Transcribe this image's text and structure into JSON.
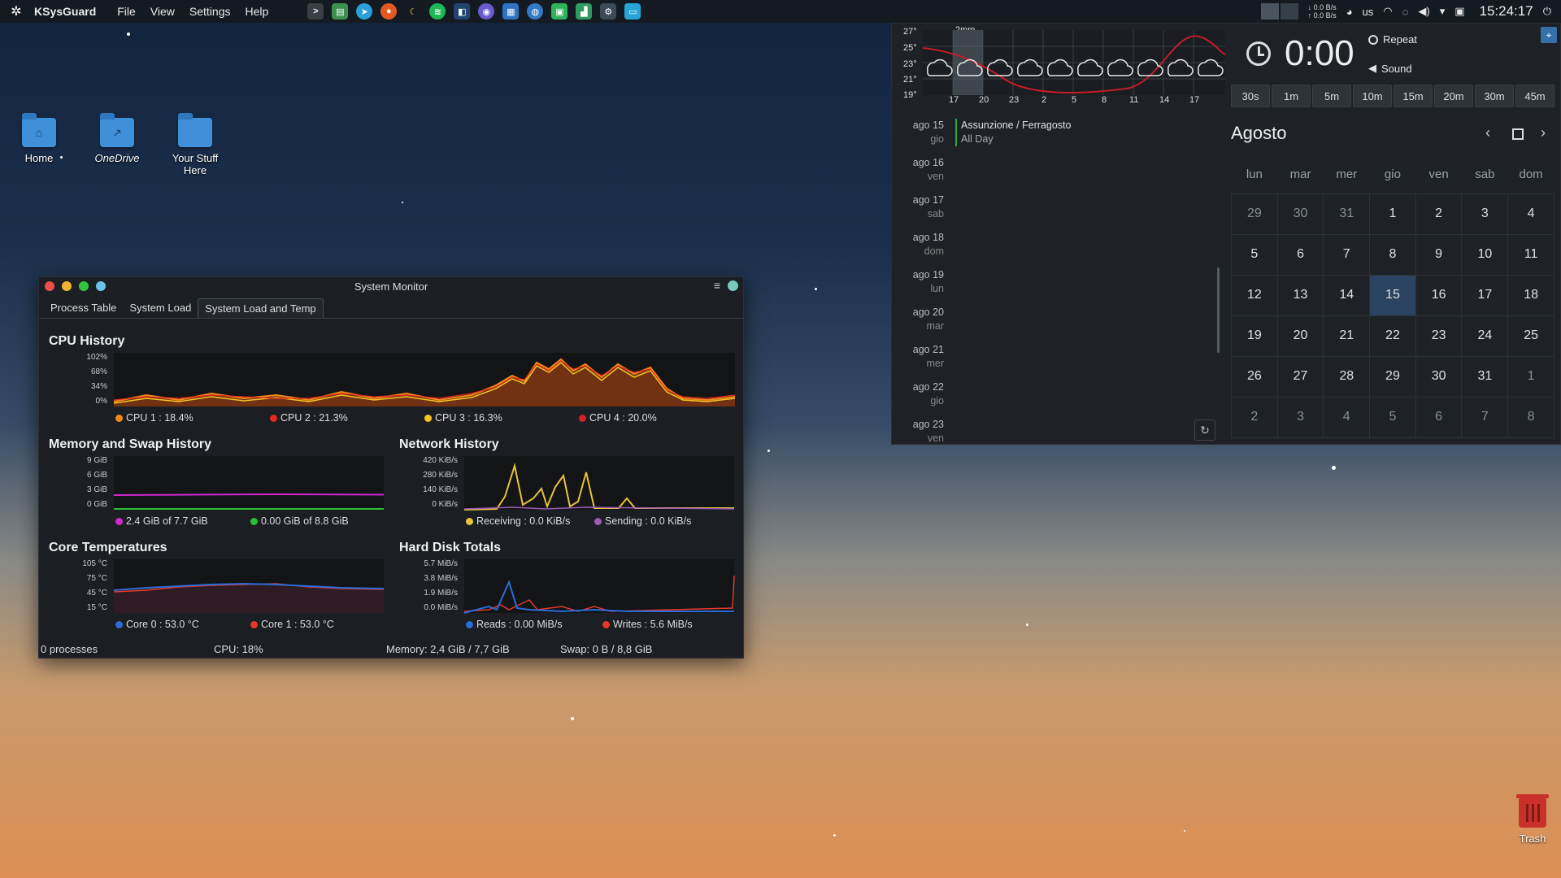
{
  "top_panel": {
    "app_name": "KSysGuard",
    "menus": [
      "File",
      "View",
      "Settings",
      "Help"
    ],
    "tray": {
      "net_up": "0.0 B/s",
      "net_down": "0.0 B/s",
      "keyboard_layout": "us",
      "clock": "15:24:17"
    }
  },
  "desktop_icons": [
    {
      "label": "Home"
    },
    {
      "label": "OneDrive"
    },
    {
      "label": "Your Stuff Here"
    }
  ],
  "trash": {
    "label": "Trash"
  },
  "system_monitor": {
    "title": "System Monitor",
    "menu_icon": "≡",
    "tabs": [
      "Process Table",
      "System Load",
      "System Load and Temp"
    ],
    "active_tab": 2,
    "cpu": {
      "title": "CPU History",
      "yticks": [
        "102%",
        "68%",
        "34%",
        "0%"
      ],
      "legend": [
        {
          "label": "CPU 1 : 18.4%",
          "color": "#f28a19"
        },
        {
          "label": "CPU 2 : 21.3%",
          "color": "#e42a1f"
        },
        {
          "label": "CPU 3 : 16.3%",
          "color": "#f5c322"
        },
        {
          "label": "CPU 4 : 20.0%",
          "color": "#d22222"
        }
      ]
    },
    "memory": {
      "title": "Memory and Swap History",
      "yticks": [
        "9 GiB",
        "6 GiB",
        "3 GiB",
        "0 GiB"
      ],
      "legend": [
        {
          "label": "2.4 GiB of 7.7 GiB",
          "color": "#d327cf"
        },
        {
          "label": "0.00 GiB of 8.8 GiB",
          "color": "#25c035"
        }
      ]
    },
    "network": {
      "title": "Network History",
      "yticks": [
        "420 KiB/s",
        "280 KiB/s",
        "140 KiB/s",
        "0 KiB/s"
      ],
      "legend": [
        {
          "label": "Receiving : 0.0 KiB/s",
          "color": "#e8c33a"
        },
        {
          "label": "Sending : 0.0 KiB/s",
          "color": "#9c5bb5"
        }
      ]
    },
    "temps": {
      "title": "Core Temperatures",
      "yticks": [
        "105 °C",
        "75 °C",
        "45 °C",
        "15 °C"
      ],
      "legend": [
        {
          "label": "Core 0 : 53.0 °C",
          "color": "#2a6cd8"
        },
        {
          "label": "Core 1 : 53.0 °C",
          "color": "#e43a2a"
        }
      ]
    },
    "disk": {
      "title": "Hard Disk Totals",
      "yticks": [
        "5.7 MiB/s",
        "3.8 MiB/s",
        "1.9 MiB/s",
        "0.0 MiB/s"
      ],
      "legend": [
        {
          "label": "Reads : 0.00 MiB/s",
          "color": "#2a6cd8"
        },
        {
          "label": "Writes : 5.6 MiB/s",
          "color": "#e43a2a"
        }
      ]
    },
    "status": {
      "processes": "0 processes",
      "cpu": "CPU: 18%",
      "memory": "Memory: 2,4 GiB / 7,7 GiB",
      "swap": "Swap: 0 B / 8,8 GiB"
    }
  },
  "weather": {
    "precip_label": "2mm",
    "temp_ticks": [
      "27°",
      "25°",
      "23°",
      "21°",
      "19°"
    ],
    "hour_ticks": [
      "17",
      "20",
      "23",
      "2",
      "5",
      "8",
      "11",
      "14",
      "17"
    ]
  },
  "events": [
    {
      "date": "ago 15",
      "day": "gio",
      "title": "Assunzione / Ferragosto",
      "subtitle": "All Day"
    },
    {
      "date": "ago 16",
      "day": "ven"
    },
    {
      "date": "ago 17",
      "day": "sab"
    },
    {
      "date": "ago 18",
      "day": "dom"
    },
    {
      "date": "ago 19",
      "day": "lun"
    },
    {
      "date": "ago 20",
      "day": "mar"
    },
    {
      "date": "ago 21",
      "day": "mer"
    },
    {
      "date": "ago 22",
      "day": "gio"
    },
    {
      "date": "ago 23",
      "day": "ven"
    }
  ],
  "timer": {
    "display": "0:00",
    "repeat_label": "Repeat",
    "sound_label": "Sound",
    "presets": [
      "30s",
      "1m",
      "5m",
      "10m",
      "15m",
      "20m",
      "30m",
      "45m"
    ]
  },
  "calendar": {
    "month": "Agosto",
    "weekdays": [
      "lun",
      "mar",
      "mer",
      "gio",
      "ven",
      "sab",
      "dom"
    ],
    "weeks": [
      [
        "29",
        "30",
        "31",
        "1",
        "2",
        "3",
        "4"
      ],
      [
        "5",
        "6",
        "7",
        "8",
        "9",
        "10",
        "11"
      ],
      [
        "12",
        "13",
        "14",
        "15",
        "16",
        "17",
        "18"
      ],
      [
        "19",
        "20",
        "21",
        "22",
        "23",
        "24",
        "25"
      ],
      [
        "26",
        "27",
        "28",
        "29",
        "30",
        "31",
        "1"
      ],
      [
        "2",
        "3",
        "4",
        "5",
        "6",
        "7",
        "8"
      ]
    ],
    "today": "15"
  }
}
